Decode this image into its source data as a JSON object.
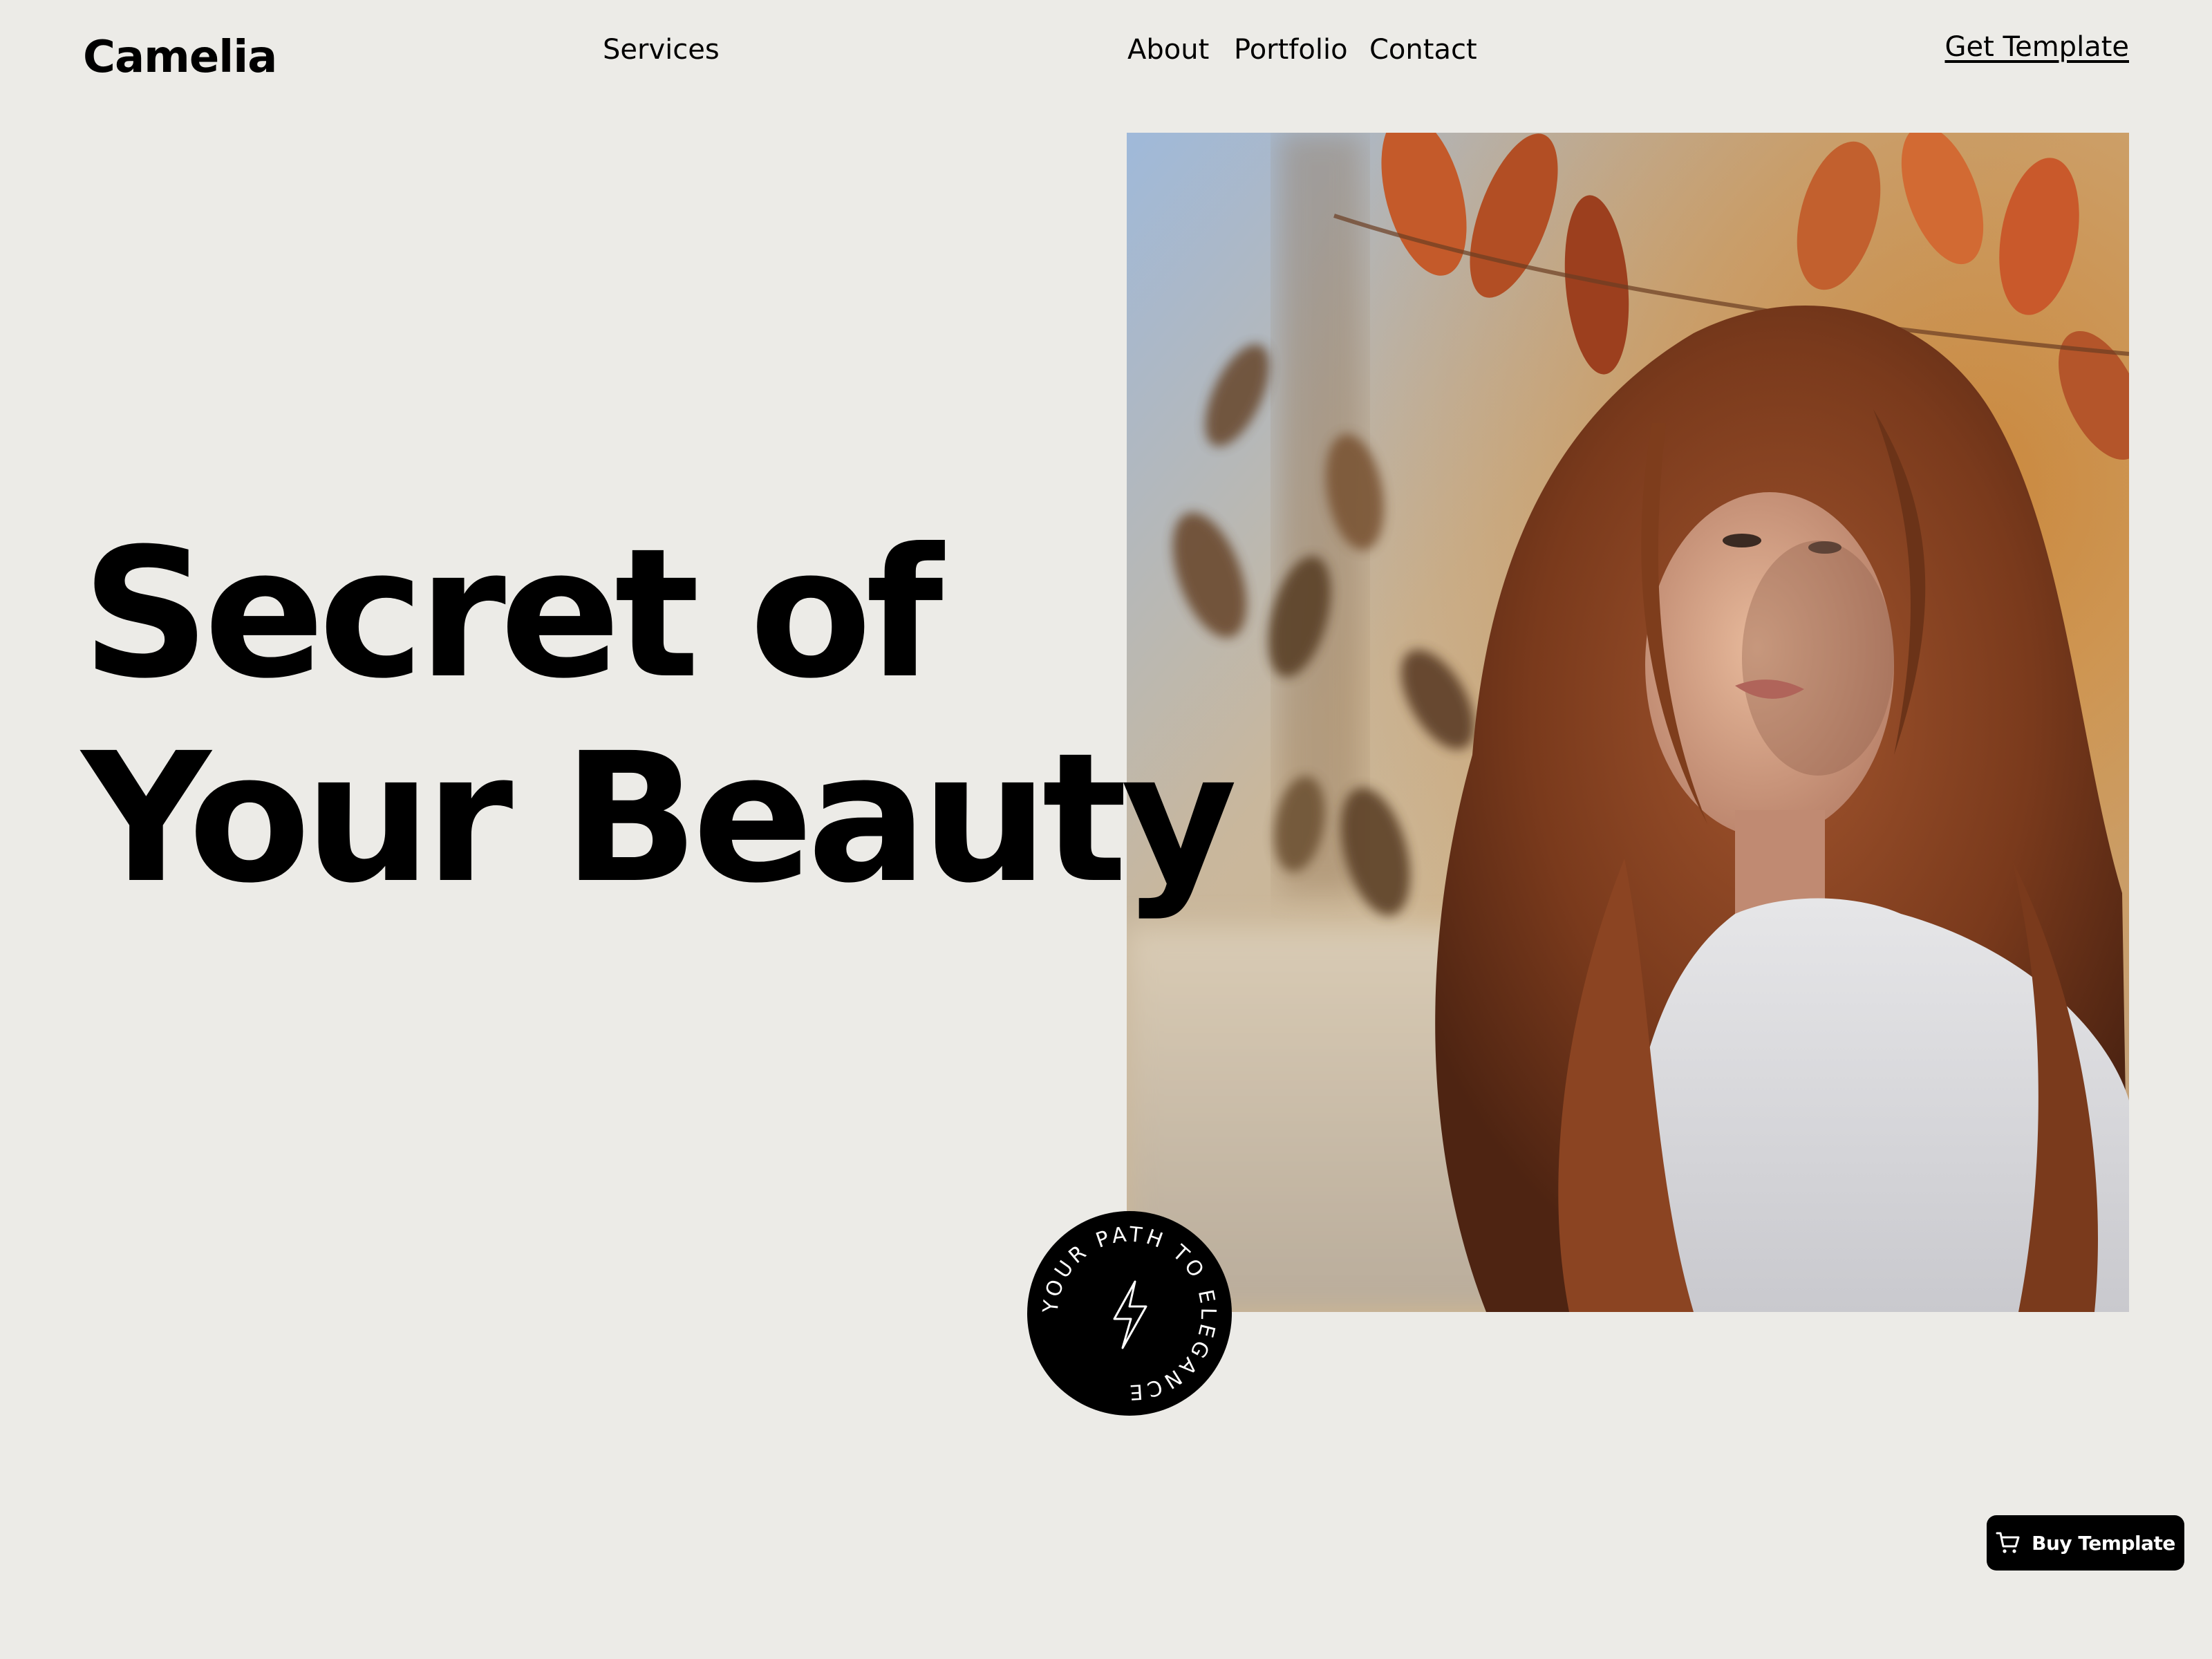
{
  "header": {
    "logo": "Camelia",
    "nav": {
      "services": "Services",
      "about": "About",
      "portfolio": "Portfolio",
      "contact": "Contact"
    },
    "get_template": "Get Template"
  },
  "hero": {
    "title_line1": "Secret of",
    "title_line2": "Your Beauty",
    "photo_icon": "portrait-photo",
    "badge": {
      "text": "YOUR PATH TO ELEGANCE",
      "icon": "lightning-bolt-icon"
    }
  },
  "buy_button": {
    "label": "Buy Template",
    "icon": "cart-icon"
  },
  "colors": {
    "background": "#ECEBE7",
    "text": "#000000",
    "button_bg": "#000000",
    "button_text": "#FFFFFF"
  }
}
